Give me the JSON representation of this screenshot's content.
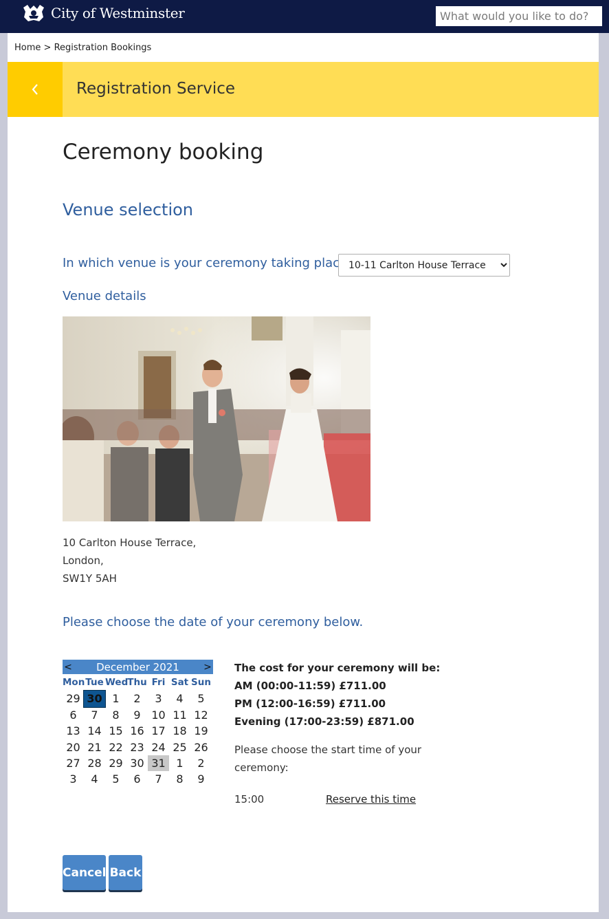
{
  "header": {
    "site_name": "City of Westminster",
    "search_placeholder": "What would you like to do?"
  },
  "breadcrumb": {
    "home": "Home",
    "separator": ">",
    "current": "Registration Bookings"
  },
  "banner": {
    "title": "Registration Service"
  },
  "main": {
    "page_title": "Ceremony booking",
    "section_title": "Venue selection",
    "venue_question": "In which venue is your ceremony taking place?",
    "venue_selected": "10-11 Carlton House Terrace",
    "venue_details_label": "Venue details",
    "address": [
      "10 Carlton House Terrace,",
      "London,",
      "SW1Y 5AH"
    ],
    "date_prompt": "Please choose the date of your ceremony below."
  },
  "calendar": {
    "prev": "<",
    "next": ">",
    "month_label": "December 2021",
    "weekdays": [
      "Mon",
      "Tue",
      "Wed",
      "Thu",
      "Fri",
      "Sat",
      "Sun"
    ],
    "weeks": [
      [
        "29",
        "30",
        "1",
        "2",
        "3",
        "4",
        "5"
      ],
      [
        "6",
        "7",
        "8",
        "9",
        "10",
        "11",
        "12"
      ],
      [
        "13",
        "14",
        "15",
        "16",
        "17",
        "18",
        "19"
      ],
      [
        "20",
        "21",
        "22",
        "23",
        "24",
        "25",
        "26"
      ],
      [
        "27",
        "28",
        "29",
        "30",
        "31",
        "1",
        "2"
      ],
      [
        "3",
        "4",
        "5",
        "6",
        "7",
        "8",
        "9"
      ]
    ],
    "today_cell": [
      0,
      1
    ],
    "selected_cell": [
      4,
      4
    ]
  },
  "pricing": {
    "heading": "The cost for your ceremony will be:",
    "am": "AM (00:00-11:59) £711.00",
    "pm": "PM (12:00-16:59) £711.00",
    "evening": "Evening (17:00-23:59) £871.00"
  },
  "time_selection": {
    "prompt": "Please choose the start time of your ceremony:",
    "time": "15:00",
    "reserve_label": "Reserve this time"
  },
  "buttons": {
    "cancel": "Cancel",
    "back": "Back"
  },
  "colors": {
    "header_bg": "#0e1a45",
    "banner_bg": "#ffdd55",
    "banner_back_bg": "#ffcc00",
    "heading_blue": "#2f5e9e",
    "button_blue": "#4a86c8"
  }
}
